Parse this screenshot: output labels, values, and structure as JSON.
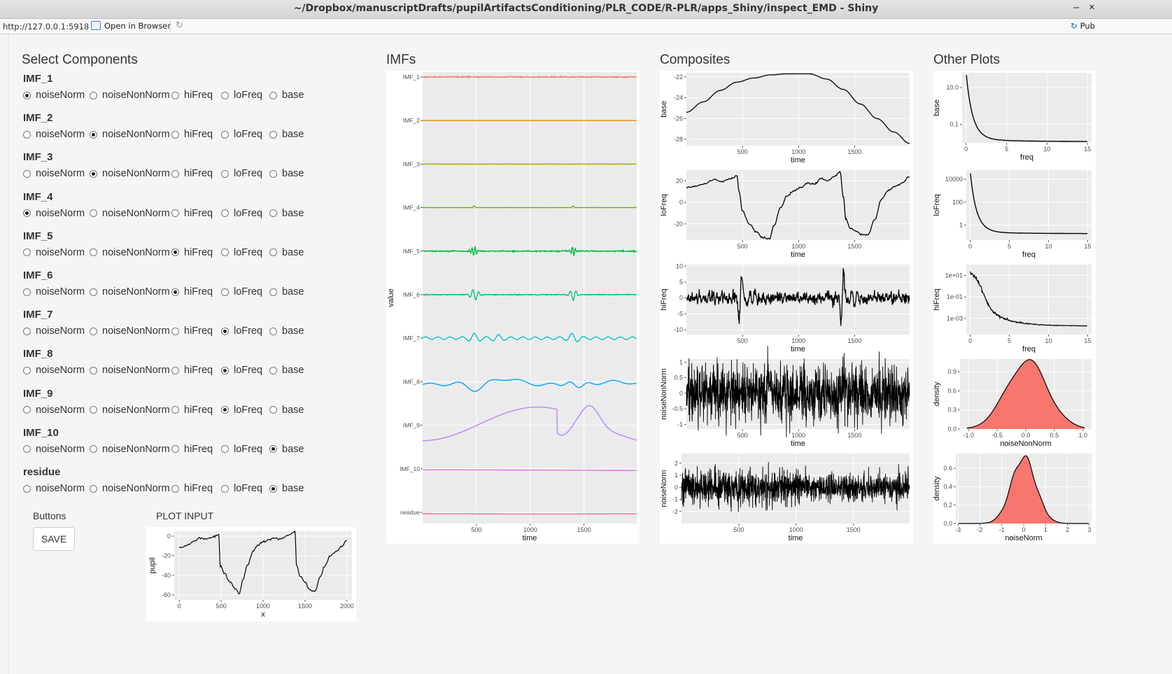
{
  "window": {
    "title": "~/Dropbox/manuscriptDrafts/pupilArtifactsConditioning/PLR_CODE/R-PLR/apps_Shiny/inspect_EMD - Shiny",
    "minimize": "–",
    "close": "×"
  },
  "addressbar": {
    "url": "http://127.0.0.1:5918",
    "open_in_browser": "Open in Browser",
    "publish": "Pub"
  },
  "sections": {
    "select": "Select Components",
    "imfs": "IMFs",
    "composites": "Composites",
    "other": "Other Plots"
  },
  "options": [
    "noiseNorm",
    "noiseNonNorm",
    "hiFreq",
    "loFreq",
    "base"
  ],
  "components": [
    {
      "label": "IMF_1",
      "selected": "noiseNorm"
    },
    {
      "label": "IMF_2",
      "selected": "noiseNonNorm"
    },
    {
      "label": "IMF_3",
      "selected": "noiseNonNorm"
    },
    {
      "label": "IMF_4",
      "selected": "noiseNorm"
    },
    {
      "label": "IMF_5",
      "selected": "hiFreq"
    },
    {
      "label": "IMF_6",
      "selected": "hiFreq"
    },
    {
      "label": "IMF_7",
      "selected": "loFreq"
    },
    {
      "label": "IMF_8",
      "selected": "loFreq"
    },
    {
      "label": "IMF_9",
      "selected": "loFreq"
    },
    {
      "label": "IMF_10",
      "selected": "base"
    },
    {
      "label": "residue",
      "selected": "base"
    }
  ],
  "buttons": {
    "label": "Buttons",
    "save": "SAVE"
  },
  "plot_input": {
    "label": "PLOT INPUT"
  },
  "colors": {
    "panel_bg": "#ebebeb",
    "grid": "#ffffff",
    "density_fill": "#f8766d"
  },
  "chart_data": [
    {
      "id": "imfs",
      "type": "line",
      "title": "",
      "xlabel": "time",
      "ylabel": "value",
      "xlim": [
        0,
        1990
      ],
      "xticks": [
        500,
        1000,
        1500
      ],
      "series": [
        {
          "name": "IMF_1",
          "color": "#f8766d",
          "shape": "hfnoise",
          "amp": 0.3
        },
        {
          "name": "IMF_2",
          "color": "#e58700",
          "shape": "flat",
          "amp": 0.04
        },
        {
          "name": "IMF_3",
          "color": "#a3a500",
          "shape": "flat",
          "amp": 0.12
        },
        {
          "name": "IMF_4",
          "color": "#6bb100",
          "shape": "flat",
          "amp": 0.12
        },
        {
          "name": "IMF_5",
          "color": "#00ba38",
          "shape": "burst",
          "amp": 0.9
        },
        {
          "name": "IMF_6",
          "color": "#00bf7d",
          "shape": "burst2",
          "amp": 1.0
        },
        {
          "name": "IMF_7",
          "color": "#00bfc4",
          "shape": "wavy7",
          "amp": 1.0
        },
        {
          "name": "IMF_8",
          "color": "#00a5ff",
          "shape": "wavy8",
          "amp": 1.0
        },
        {
          "name": "IMF_9",
          "color": "#b983ff",
          "shape": "slow9",
          "amp": 1.0
        },
        {
          "name": "IMF_10",
          "color": "#e76bf3",
          "shape": "resid10",
          "amp": 1.0
        },
        {
          "name": "residue",
          "color": "#ff67a4",
          "shape": "residue",
          "amp": 1.0
        }
      ]
    },
    {
      "id": "comp-base",
      "type": "line",
      "xlabel": "time",
      "ylabel": "base",
      "xlim": [
        0,
        1990
      ],
      "ylim": [
        -28.6,
        -21.6
      ],
      "xticks": [
        500,
        1000,
        1500
      ],
      "yticks": [
        -22,
        -24,
        -26,
        -28
      ],
      "points": [
        [
          0,
          -25.4
        ],
        [
          150,
          -24.4
        ],
        [
          300,
          -23.3
        ],
        [
          450,
          -22.5
        ],
        [
          600,
          -22.1
        ],
        [
          750,
          -21.8
        ],
        [
          900,
          -21.7
        ],
        [
          1100,
          -21.7
        ],
        [
          1250,
          -22.2
        ],
        [
          1400,
          -23.2
        ],
        [
          1550,
          -24.6
        ],
        [
          1700,
          -26.0
        ],
        [
          1850,
          -27.3
        ],
        [
          1990,
          -28.4
        ]
      ]
    },
    {
      "id": "comp-lofreq",
      "type": "line",
      "xlabel": "time",
      "ylabel": "loFreq",
      "xlim": [
        0,
        1990
      ],
      "ylim": [
        -35,
        30
      ],
      "xticks": [
        500,
        1000,
        1500
      ],
      "yticks": [
        20,
        0,
        -20
      ],
      "points": [
        [
          0,
          14
        ],
        [
          80,
          15
        ],
        [
          160,
          17
        ],
        [
          240,
          21
        ],
        [
          320,
          19
        ],
        [
          400,
          22
        ],
        [
          450,
          25
        ],
        [
          470,
          10
        ],
        [
          500,
          -8
        ],
        [
          560,
          -20
        ],
        [
          620,
          -27
        ],
        [
          680,
          -33
        ],
        [
          740,
          -34
        ],
        [
          780,
          -22
        ],
        [
          840,
          -5
        ],
        [
          900,
          6
        ],
        [
          960,
          11
        ],
        [
          1020,
          14
        ],
        [
          1080,
          18
        ],
        [
          1140,
          17
        ],
        [
          1200,
          22
        ],
        [
          1260,
          20
        ],
        [
          1320,
          24
        ],
        [
          1370,
          28
        ],
        [
          1400,
          5
        ],
        [
          1420,
          -15
        ],
        [
          1460,
          -24
        ],
        [
          1520,
          -27
        ],
        [
          1560,
          -30
        ],
        [
          1620,
          -30
        ],
        [
          1680,
          -16
        ],
        [
          1740,
          3
        ],
        [
          1800,
          11
        ],
        [
          1860,
          15
        ],
        [
          1920,
          18
        ],
        [
          1990,
          24
        ]
      ]
    },
    {
      "id": "comp-hifreq",
      "type": "line",
      "xlabel": "time",
      "ylabel": "hiFreq",
      "xlim": [
        0,
        1990
      ],
      "ylim": [
        -11.5,
        10.5
      ],
      "xticks": [
        500,
        1000,
        1500
      ],
      "yticks": [
        10,
        5,
        0,
        -5,
        -10
      ],
      "shape": "hifreq"
    },
    {
      "id": "comp-noisenonnorm",
      "type": "line",
      "xlabel": "time",
      "ylabel": "noiseNonNorm",
      "xlim": [
        0,
        1990
      ],
      "ylim": [
        -1.15,
        1.1
      ],
      "xticks": [
        500,
        1000,
        1500
      ],
      "yticks": [
        1.0,
        0.5,
        0.0,
        -0.5,
        -1.0
      ],
      "shape": "noise",
      "amp": 0.45
    },
    {
      "id": "comp-noisenorm",
      "type": "line",
      "xlabel": "time",
      "ylabel": "noiseNorm",
      "xlim": [
        0,
        1990
      ],
      "ylim": [
        -3,
        2.8
      ],
      "xticks": [
        500,
        1000,
        1500
      ],
      "yticks": [
        2,
        1,
        0,
        -1,
        -2
      ],
      "shape": "noise",
      "amp": 0.75
    },
    {
      "id": "other-base",
      "type": "line",
      "xlabel": "freq",
      "ylabel": "base",
      "xlim": [
        -0.5,
        15.5
      ],
      "xticks": [
        0,
        5,
        10,
        15
      ],
      "ylog": true,
      "ylim_log10": [
        -2.0,
        1.8
      ],
      "yticks": [
        [
          "10.0",
          1
        ],
        [
          "0.1",
          -1
        ]
      ],
      "shape": "spectrum",
      "params": {
        "a": 1.7,
        "b": -1.95
      }
    },
    {
      "id": "other-lofreq",
      "type": "line",
      "xlabel": "freq",
      "ylabel": "loFreq",
      "xlim": [
        -0.5,
        15.5
      ],
      "xticks": [
        0,
        5,
        10,
        15
      ],
      "ylog": true,
      "ylim_log10": [
        -1.3,
        4.8
      ],
      "yticks": [
        [
          "10000",
          4
        ],
        [
          "100",
          2
        ],
        [
          "1",
          0
        ]
      ],
      "shape": "spectrum",
      "params": {
        "a": 4.6,
        "b": -0.75
      }
    },
    {
      "id": "other-hifreq",
      "type": "line",
      "xlabel": "freq",
      "ylabel": "hiFreq",
      "xlim": [
        -0.5,
        15.5
      ],
      "xticks": [
        0,
        5,
        10,
        15
      ],
      "ylog": true,
      "ylim_log10": [
        -4.5,
        2.0
      ],
      "yticks": [
        [
          "1e+01",
          1
        ],
        [
          "1e-01",
          -1
        ],
        [
          "1e-03",
          -3
        ]
      ],
      "shape": "hispectrum"
    },
    {
      "id": "other-noisenonnorm",
      "type": "area",
      "xlabel": "noiseNonNorm",
      "ylabel": "density",
      "xlim": [
        -1.15,
        1.15
      ],
      "ylim": [
        0,
        1.1
      ],
      "xticks": [
        -1.0,
        -0.5,
        0.0,
        0.5,
        1.0
      ],
      "xticklabels": [
        "-1.0",
        "-0.5",
        "0.0",
        "0.5",
        "1.0"
      ],
      "yticks": [
        0.0,
        0.3,
        0.6,
        0.9
      ],
      "yticklabels": [
        "0.0",
        "0.3",
        "0.6",
        "0.9"
      ],
      "shape": "density",
      "params": {
        "mu": 0.02,
        "sd": 0.36,
        "peak": 1.07
      }
    },
    {
      "id": "other-noisenorm",
      "type": "area",
      "xlabel": "noiseNorm",
      "ylabel": "density",
      "xlim": [
        -3.1,
        3.1
      ],
      "ylim": [
        0,
        0.76
      ],
      "xticks": [
        -3,
        -2,
        -1,
        0,
        1,
        2,
        3
      ],
      "xticklabels": [
        "-3",
        "-2",
        "-1",
        "0",
        "1",
        "2",
        "3"
      ],
      "yticks": [
        0.0,
        0.2,
        0.4,
        0.6
      ],
      "yticklabels": [
        "0.0",
        "0.2",
        "0.4",
        "0.6"
      ],
      "shape": "density",
      "params": {
        "mu": 0.0,
        "sd": 0.56,
        "peak": 0.72
      }
    },
    {
      "id": "plot-input",
      "type": "line",
      "xlabel": "x",
      "ylabel": "pupil",
      "xlim": [
        -60,
        2060
      ],
      "ylim": [
        -65,
        5
      ],
      "xticks": [
        0,
        500,
        1000,
        1500,
        2000
      ],
      "yticks": [
        0,
        -20,
        -40,
        -60
      ],
      "points": [
        [
          0,
          -12
        ],
        [
          80,
          -10
        ],
        [
          160,
          -6
        ],
        [
          240,
          -2
        ],
        [
          320,
          -3
        ],
        [
          400,
          -1
        ],
        [
          470,
          1
        ],
        [
          490,
          -30
        ],
        [
          540,
          -38
        ],
        [
          600,
          -46
        ],
        [
          660,
          -53
        ],
        [
          720,
          -58
        ],
        [
          760,
          -44
        ],
        [
          820,
          -28
        ],
        [
          880,
          -16
        ],
        [
          940,
          -9
        ],
        [
          1000,
          -6
        ],
        [
          1060,
          -4
        ],
        [
          1120,
          -2
        ],
        [
          1200,
          -3
        ],
        [
          1280,
          0
        ],
        [
          1380,
          4
        ],
        [
          1400,
          -30
        ],
        [
          1440,
          -40
        ],
        [
          1500,
          -47
        ],
        [
          1560,
          -55
        ],
        [
          1620,
          -56
        ],
        [
          1680,
          -42
        ],
        [
          1740,
          -30
        ],
        [
          1800,
          -20
        ],
        [
          1880,
          -15
        ],
        [
          1940,
          -10
        ],
        [
          2000,
          -4
        ]
      ]
    }
  ]
}
